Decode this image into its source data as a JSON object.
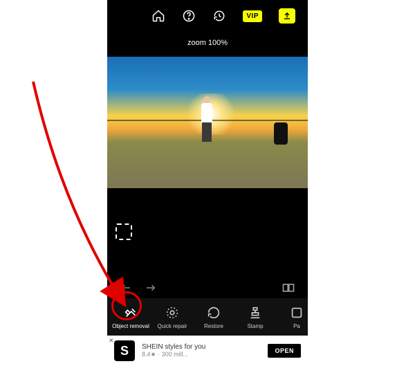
{
  "top": {
    "vip_label": "VIP"
  },
  "zoom_label": "zoom 100%",
  "tools": {
    "object_removal": "Object removal",
    "quick_repair": "Quick repair",
    "restore": "Restore",
    "stamp": "Stamp",
    "partial": "Pa"
  },
  "ad": {
    "logo_letter": "S",
    "title": "SHEIN styles for you",
    "subtitle": "8.4★ · 300 mill...",
    "cta": "OPEN"
  }
}
